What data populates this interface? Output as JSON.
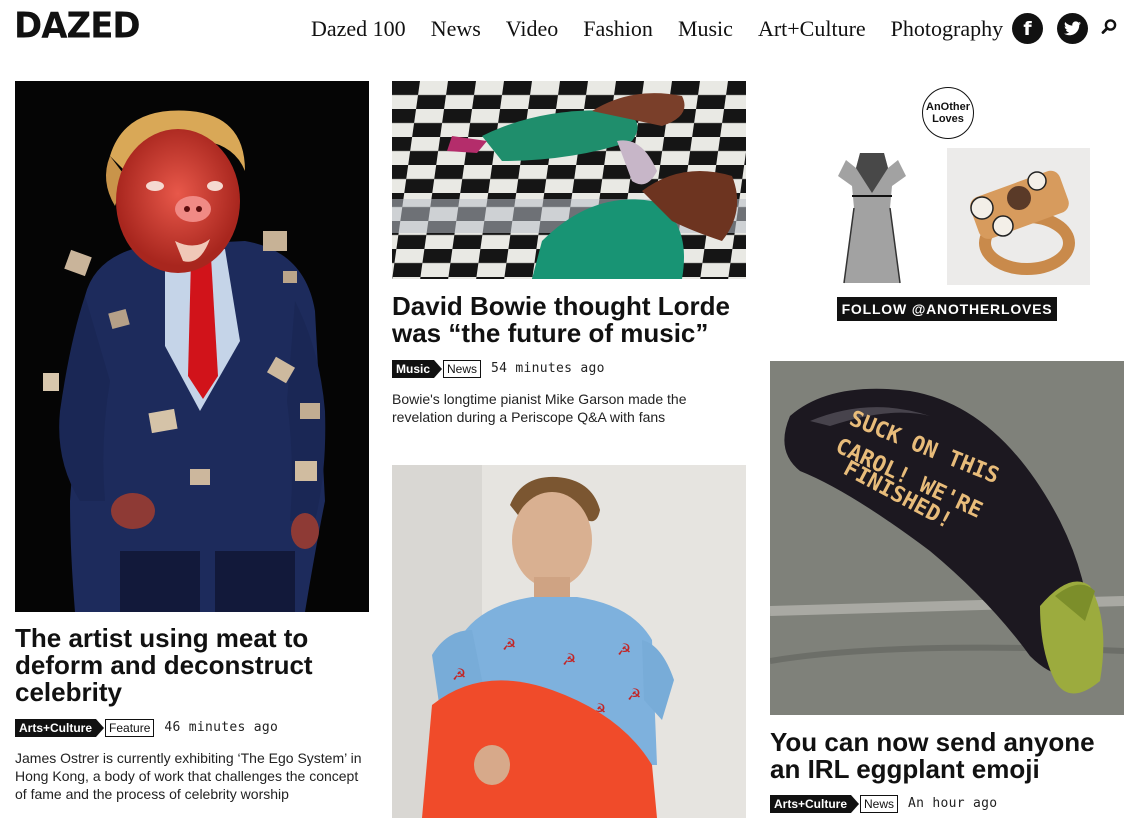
{
  "header": {
    "logo": "DAZED",
    "nav": [
      "Dazed 100",
      "News",
      "Video",
      "Fashion",
      "Music",
      "Art+Culture",
      "Photography"
    ],
    "social": {
      "facebook_glyph": "f",
      "twitter_icon": "twitter-icon"
    },
    "search_icon": "search-icon"
  },
  "articles": {
    "meat": {
      "headline": "The artist using meat to deform and deconstruct celebrity",
      "category": "Arts+Culture",
      "type": "Feature",
      "time": "46 minutes ago",
      "description": "James Ostrer is currently exhibiting ‘The Ego System’ in Hong Kong, a body of work that challenges the concept of fame and the process of celebrity worship"
    },
    "bowie": {
      "headline": "David Bowie thought Lorde was “the future of music”",
      "category": "Music",
      "type": "News",
      "time": "54 minutes ago",
      "description": "Bowie's longtime pianist Mike Garson made the revelation during a Periscope Q&A with fans"
    },
    "eggplant": {
      "headline": "You can now send anyone an IRL eggplant emoji",
      "category": "Arts+Culture",
      "type": "News",
      "time": "An hour ago",
      "image_text": [
        "SUCK ON THIS",
        "CAROL! WE'RE",
        "FINISHED!"
      ]
    }
  },
  "sidebar": {
    "badge_line1": "AnOther",
    "badge_line2": "Loves",
    "follow_label": "FOLLOW @ANOTHERLOVES"
  },
  "colors": {
    "text": "#111111",
    "background": "#ffffff",
    "eggplant_bg": "#7d8079"
  }
}
